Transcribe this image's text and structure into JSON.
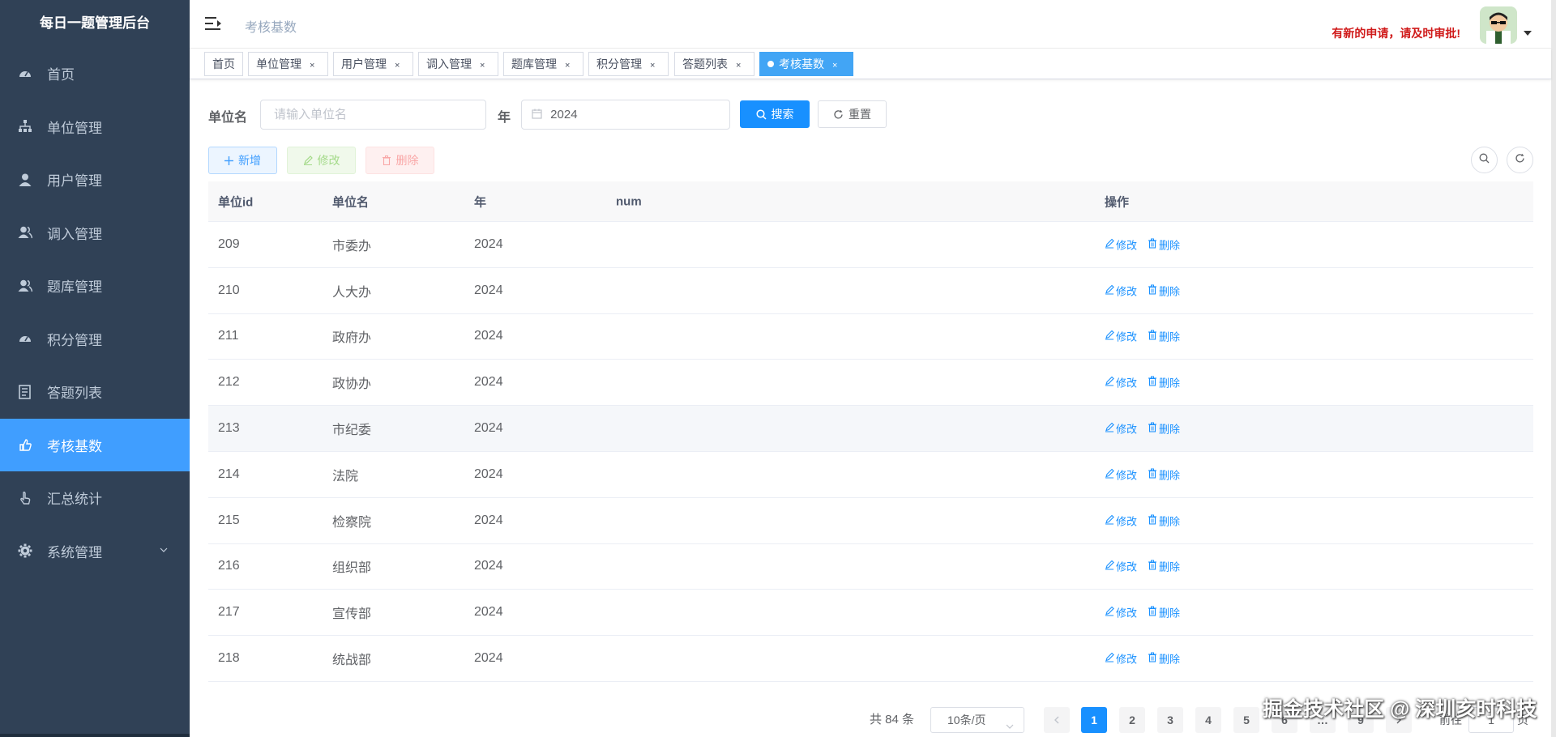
{
  "app": {
    "title": "每日一题管理后台"
  },
  "sidebar": {
    "items": [
      {
        "label": "首页",
        "icon": "dashboard-icon"
      },
      {
        "label": "单位管理",
        "icon": "tree-icon"
      },
      {
        "label": "用户管理",
        "icon": "user-icon"
      },
      {
        "label": "调入管理",
        "icon": "peoples-icon"
      },
      {
        "label": "题库管理",
        "icon": "peoples-icon"
      },
      {
        "label": "积分管理",
        "icon": "dashboard-icon"
      },
      {
        "label": "答题列表",
        "icon": "list-icon"
      },
      {
        "label": "考核基数",
        "icon": "hand-icon",
        "active": true
      },
      {
        "label": "汇总统计",
        "icon": "pointer-icon"
      },
      {
        "label": "系统管理",
        "icon": "gear-icon",
        "has_children": true
      }
    ],
    "active_color": "#409eff",
    "background": "#304156"
  },
  "navbar": {
    "breadcrumb": "考核基数",
    "notice": "有新的申请，请及时审批!"
  },
  "tags": [
    "首页",
    "单位管理",
    "用户管理",
    "调入管理",
    "题库管理",
    "积分管理",
    "答题列表",
    "考核基数"
  ],
  "search": {
    "unit_label": "单位名",
    "unit_placeholder": "请输入单位名",
    "year_label": "年",
    "year_value": "2024",
    "search_btn": "搜索",
    "reset_btn": "重置"
  },
  "toolbar": {
    "add": "新增",
    "edit": "修改",
    "delete": "删除"
  },
  "table": {
    "headers": [
      "单位id",
      "单位名",
      "年",
      "num",
      "操作"
    ],
    "rows": [
      {
        "id": "209",
        "name": "市委办",
        "year": "2024",
        "num": ""
      },
      {
        "id": "210",
        "name": "人大办",
        "year": "2024",
        "num": ""
      },
      {
        "id": "211",
        "name": "政府办",
        "year": "2024",
        "num": ""
      },
      {
        "id": "212",
        "name": "政协办",
        "year": "2024",
        "num": ""
      },
      {
        "id": "213",
        "name": "市纪委",
        "year": "2024",
        "num": "",
        "hover": true
      },
      {
        "id": "214",
        "name": "法院",
        "year": "2024",
        "num": ""
      },
      {
        "id": "215",
        "name": "检察院",
        "year": "2024",
        "num": ""
      },
      {
        "id": "216",
        "name": "组织部",
        "year": "2024",
        "num": ""
      },
      {
        "id": "217",
        "name": "宣传部",
        "year": "2024",
        "num": ""
      },
      {
        "id": "218",
        "name": "统战部",
        "year": "2024",
        "num": ""
      }
    ],
    "op_edit": "修改",
    "op_delete": "删除"
  },
  "pagination": {
    "total_text": "共 84 条",
    "page_size": "10条/页",
    "pages": [
      "1",
      "2",
      "3",
      "4",
      "5",
      "6",
      "…",
      "9"
    ],
    "current": "1",
    "goto_label": "前往",
    "goto_value": "1",
    "page_unit": "页"
  },
  "watermark": "掘金技术社区 @ 深圳亥时科技"
}
